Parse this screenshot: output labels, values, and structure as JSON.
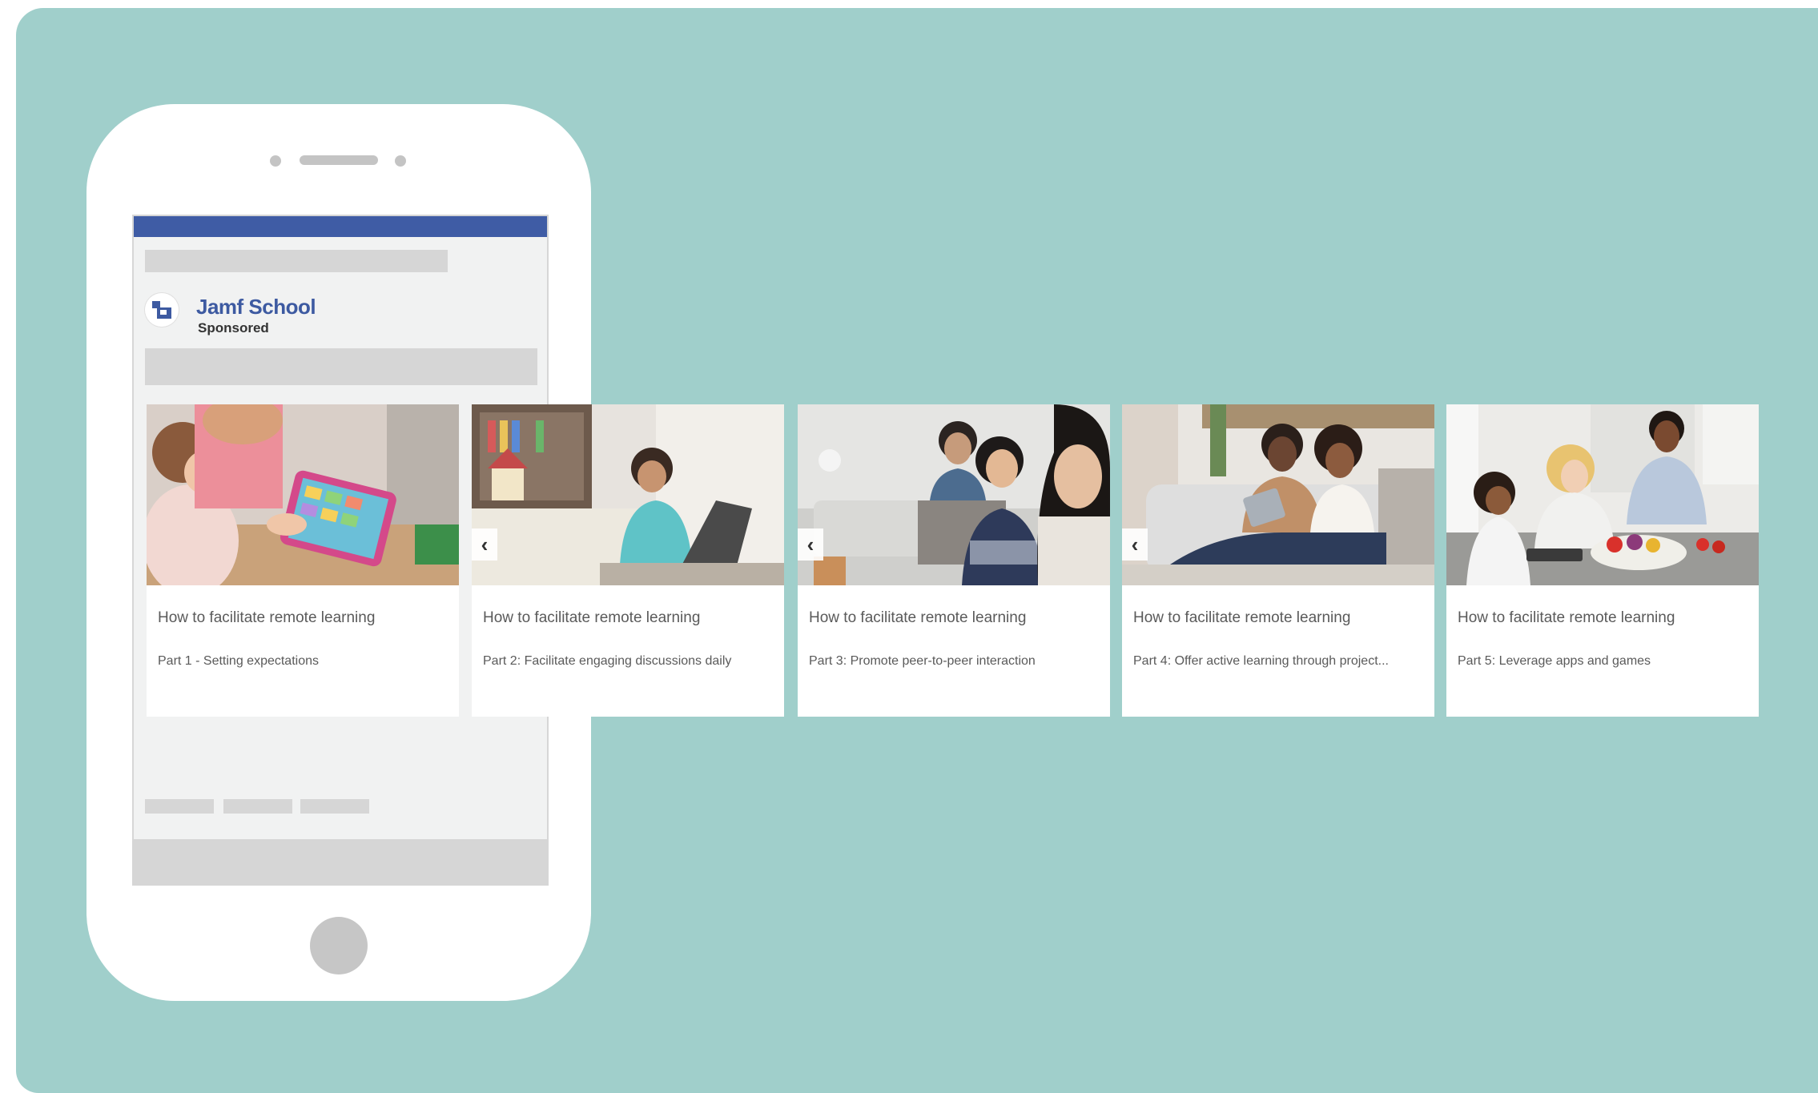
{
  "advertiser": {
    "name": "Jamf School",
    "label": "Sponsored"
  },
  "carousel": {
    "cards": [
      {
        "title": "How to facilitate remote learning",
        "subtitle": "Part 1 - Setting expectations",
        "image": "teacher-with-child-using-tablet"
      },
      {
        "title": "How to facilitate remote learning",
        "subtitle": "Part 2: Facilitate engaging discussions daily",
        "image": "girl-on-laptop-at-home"
      },
      {
        "title": "How to facilitate remote learning",
        "subtitle": "Part 3: Promote peer-to-peer interaction",
        "image": "family-talking-on-couch"
      },
      {
        "title": "How to facilitate remote learning",
        "subtitle": "Part 4: Offer active learning through project...",
        "image": "parent-and-child-with-tablet-on-sofa"
      },
      {
        "title": "How to facilitate remote learning",
        "subtitle": "Part 5: Leverage apps and games",
        "image": "family-in-kitchen-with-tablet"
      }
    ],
    "prev_icon": "chevron-left-icon"
  },
  "colors": {
    "background": "#a0cfcb",
    "facebook_blue": "#3f5ca5",
    "brand_text": "#3d5aa1"
  }
}
